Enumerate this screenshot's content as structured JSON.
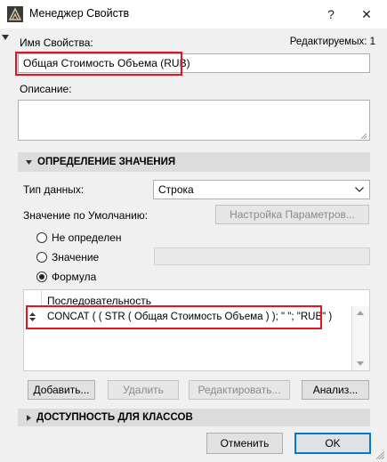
{
  "window": {
    "title": "Менеджер Свойств",
    "help_label": "?",
    "close_label": "✕"
  },
  "header": {
    "editable_count": "Редактируемых: 1"
  },
  "name_field": {
    "label": "Имя Свойства:",
    "value": "Общая Стоимость Объема (RUB)"
  },
  "description_field": {
    "label": "Описание:",
    "value": ""
  },
  "value_definition": {
    "section_title": "ОПРЕДЕЛЕНИЕ ЗНАЧЕНИЯ",
    "data_type_label": "Тип данных:",
    "data_type_value": "Строка",
    "default_value_label": "Значение по Умолчанию:",
    "settings_button": "Настройка Параметров...",
    "radios": [
      {
        "label": "Не определен",
        "selected": false
      },
      {
        "label": "Значение",
        "selected": false
      },
      {
        "label": "Формула",
        "selected": true
      }
    ],
    "sequence_header": "Последовательность",
    "formula": "CONCAT ( ( STR ( Общая Стоимость Объема ) ); \" \"; \"RUB\" )",
    "buttons": {
      "add": "Добавить...",
      "delete": "Удалить",
      "edit": "Редактировать...",
      "analyze": "Анализ..."
    }
  },
  "class_availability": {
    "section_title": "ДОСТУПНОСТЬ ДЛЯ КЛАССОВ"
  },
  "footer": {
    "cancel": "Отменить",
    "ok": "OK"
  },
  "colors": {
    "highlight": "#e81123",
    "ok_border": "#0078d7",
    "section_bg": "#dcdcdc"
  }
}
